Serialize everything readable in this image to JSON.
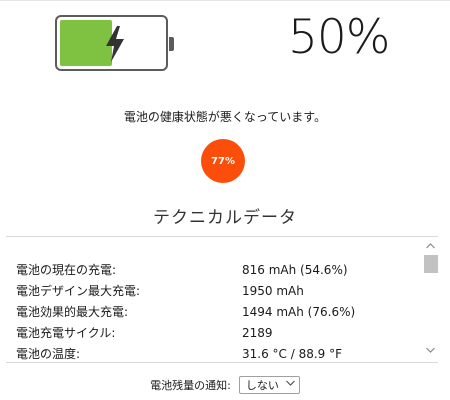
{
  "battery": {
    "level_percent": 50,
    "fill_color": "#7fc241",
    "icon": "charging-bolt-icon",
    "charge_text": "50%"
  },
  "health": {
    "message": "電池の健康状態が悪くなっています。",
    "score_text": "77%",
    "score_percent": 77,
    "badge_color": "#fa4e0a"
  },
  "technical": {
    "title": "テクニカルデータ",
    "rows": [
      {
        "label": "電池の現在の充電:",
        "value": "816 mAh (54.6%)"
      },
      {
        "label": "電池デザイン最大充電:",
        "value": "1950 mAh"
      },
      {
        "label": "電池効果的最大充電:",
        "value": "1494 mAh (76.6%)"
      },
      {
        "label": "電池充電サイクル:",
        "value": "2189"
      },
      {
        "label": "電池の温度:",
        "value": "31.6 °C / 88.9 °F"
      }
    ],
    "scroll_up_icon": "chevron-up-icon",
    "scroll_down_icon": "chevron-down-icon"
  },
  "notification": {
    "label": "電池残量の通知:",
    "selected": "しない",
    "chevron_icon": "chevron-down-icon"
  }
}
